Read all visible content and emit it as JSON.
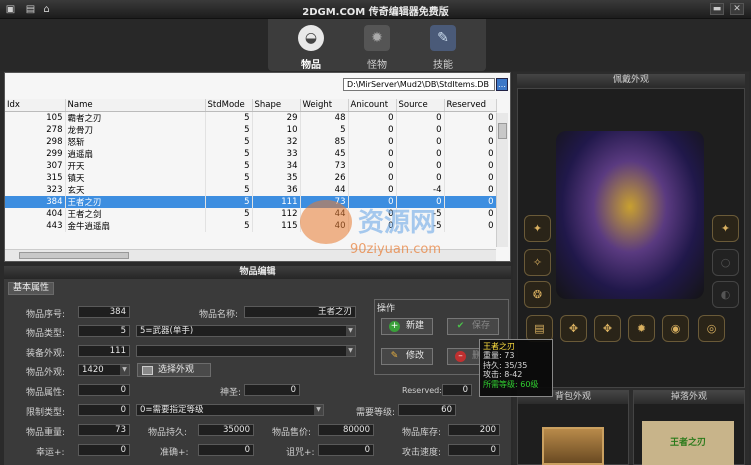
{
  "window": {
    "title": "2DGM.COM 传奇编辑器免费版",
    "icons": [
      "save-icon",
      "home-icon"
    ]
  },
  "tabs": [
    {
      "label": "物品",
      "icon": "bag-icon",
      "active": true
    },
    {
      "label": "怪物",
      "icon": "monster-icon",
      "active": false
    },
    {
      "label": "技能",
      "icon": "skill-book-icon",
      "active": false
    }
  ],
  "grid": {
    "path": "D:\\MirServer\\Mud2\\DB\\StdItems.DB",
    "columns": [
      "Idx",
      "Name",
      "StdMode",
      "Shape",
      "Weight",
      "Anicount",
      "Source",
      "Reserved"
    ],
    "rows": [
      [
        "105",
        "霸者之刃",
        "5",
        "29",
        "48",
        "0",
        "0",
        "0"
      ],
      [
        "278",
        "龙骨刀",
        "5",
        "10",
        "5",
        "0",
        "0",
        "0"
      ],
      [
        "298",
        "怒斩",
        "5",
        "32",
        "85",
        "0",
        "0",
        "0"
      ],
      [
        "299",
        "逍遥扇",
        "5",
        "33",
        "45",
        "0",
        "0",
        "0"
      ],
      [
        "307",
        "开天",
        "5",
        "34",
        "73",
        "0",
        "0",
        "0"
      ],
      [
        "315",
        "镇天",
        "5",
        "35",
        "26",
        "0",
        "0",
        "0"
      ],
      [
        "323",
        "玄天",
        "5",
        "36",
        "44",
        "0",
        "-4",
        "0"
      ],
      [
        "384",
        "王者之刃",
        "5",
        "111",
        "73",
        "0",
        "0",
        "0"
      ],
      [
        "404",
        "王者之剑",
        "5",
        "112",
        "44",
        "0",
        "-5",
        "0"
      ],
      [
        "443",
        "金牛逍遥扇",
        "5",
        "115",
        "40",
        "0",
        "-5",
        "0"
      ]
    ],
    "selected_index": 7
  },
  "editor": {
    "header": "物品编辑",
    "tab": "基本属性",
    "item_no_label": "物品序号:",
    "item_no": "384",
    "item_name_label": "物品名称:",
    "item_name": "王者之刃",
    "type_label": "物品类型:",
    "type_code": "5",
    "type_name": "5=武器(单手)",
    "equip_look_label": "装备外观:",
    "equip_look": "111",
    "item_look_label": "物品外观:",
    "item_look": "1420",
    "choose_look_button": "选择外观",
    "attr_label": "物品属性:",
    "attr": "0",
    "holy_label": "神圣:",
    "holy": "0",
    "reserved_label": "Reserved:",
    "reserved": "0",
    "limit_type_label": "限制类型:",
    "limit_type": "0",
    "limit_type_name": "0=需要指定等级",
    "need_level_label": "需要等级:",
    "need_level": "60",
    "weight_label": "物品重量:",
    "weight": "73",
    "durability_label": "物品持久:",
    "durability": "35000",
    "price_label": "物品售价:",
    "price": "80000",
    "stock_label": "物品库存:",
    "stock": "200",
    "luck_label": "幸运+:",
    "luck": "0",
    "accuracy_label": "准确+:",
    "accuracy": "0",
    "curse_label": "诅咒+:",
    "curse": "0",
    "atk_speed_label": "攻击速度:",
    "atk_speed": "0"
  },
  "ops": {
    "title": "操作",
    "new_button": "新建",
    "save_button": "保存",
    "modify_button": "修改",
    "delete_button": "删除"
  },
  "preview": {
    "wear_title": "佩戴外观",
    "bag_title": "背包外观",
    "drop_title": "掉落外观",
    "drop_name": "王者之刃"
  },
  "tooltip": {
    "name": "王者之刃",
    "weight": "重量: 73",
    "durability": "持久: 35/35",
    "attack": "攻击: 8-42",
    "need": "所需等级: 60级"
  },
  "watermark": {
    "text": "资源网",
    "url": "90ziyuan.com"
  },
  "colors": {
    "selection": "#3d8ee0",
    "tooltip_name": "#ffe040",
    "tooltip_need": "#30d030"
  }
}
